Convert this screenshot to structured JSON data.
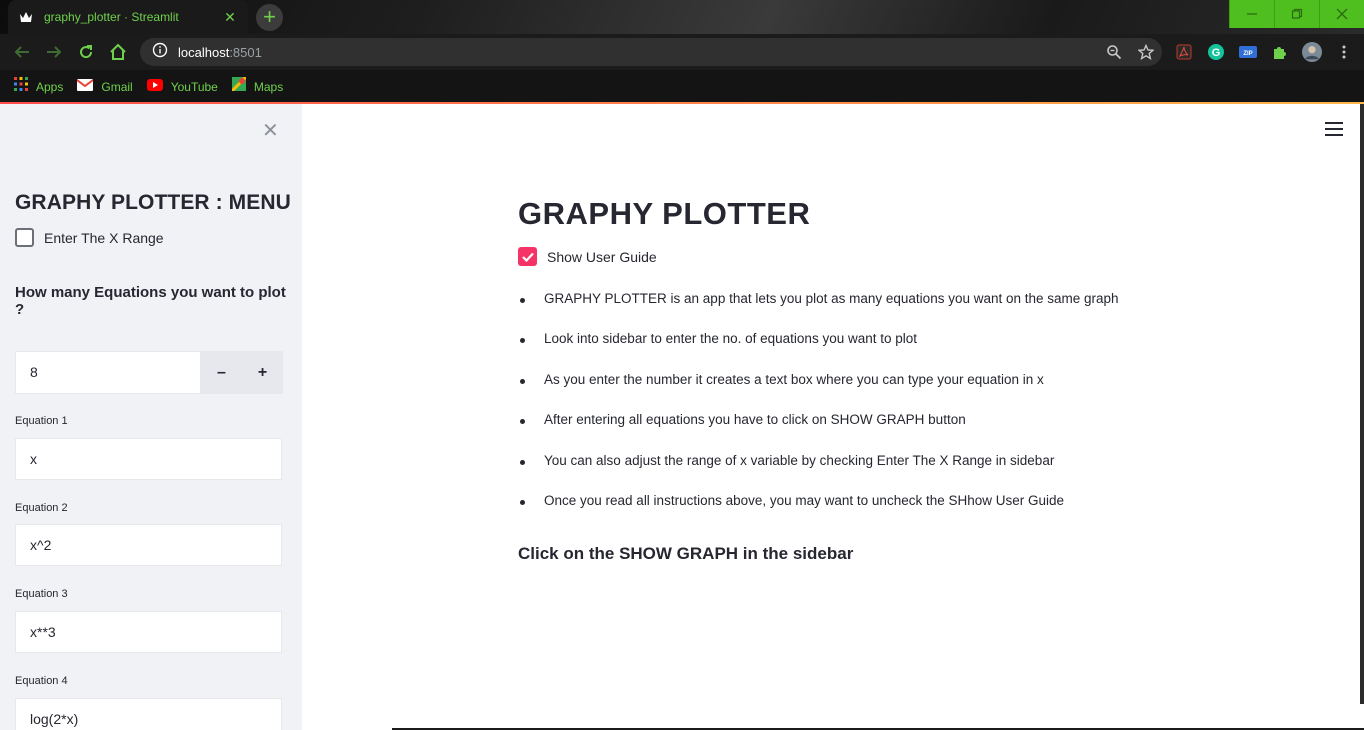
{
  "browser": {
    "tab_title": "graphy_plotter · Streamlit",
    "url_host": "localhost",
    "url_port": ":8501",
    "bookmarks": [
      {
        "label": "Apps"
      },
      {
        "label": "Gmail"
      },
      {
        "label": "YouTube"
      },
      {
        "label": "Maps"
      }
    ],
    "accent_color": "#6fd14b"
  },
  "sidebar": {
    "title": "GRAPHY PLOTTER : MENU",
    "x_range_label": "Enter The X Range",
    "question": "How many Equations you want to plot ?",
    "equation_count": "8",
    "minus_label": "–",
    "plus_label": "+",
    "equations": [
      {
        "label": "Equation 1",
        "value": "x"
      },
      {
        "label": "Equation 2",
        "value": "x^2"
      },
      {
        "label": "Equation 3",
        "value": "x**3"
      },
      {
        "label": "Equation 4",
        "value": "log(2*x)"
      }
    ]
  },
  "main": {
    "title": "GRAPHY PLOTTER",
    "show_guide_label": "Show User Guide",
    "guide_items": [
      "GRAPHY PLOTTER is an app that lets you plot as many equations you want on the same graph",
      "Look into sidebar to enter the no. of equations you want to plot",
      "As you enter the number it creates a text box where you can type your equation in x",
      "After entering all equations you have to click on SHOW GRAPH button",
      "You can also adjust the range of x variable by checking Enter The X Range in sidebar",
      "Once you read all instructions above, you may want to uncheck the SHhow User Guide"
    ],
    "subheading": "Click on the SHOW GRAPH in the sidebar",
    "checkbox_color": "#f63366"
  }
}
